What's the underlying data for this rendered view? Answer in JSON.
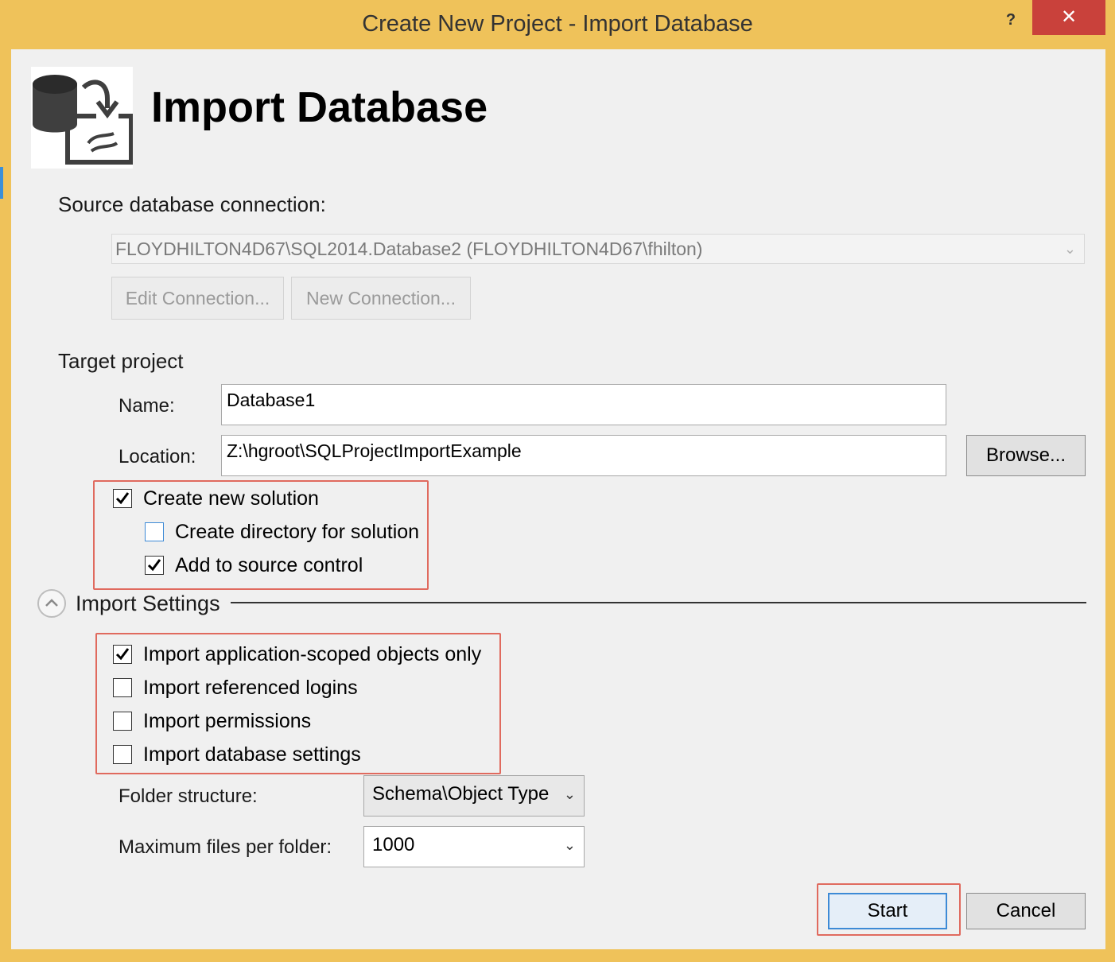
{
  "window": {
    "title": "Create New Project - Import Database",
    "help_label": "?",
    "close_label": "✕"
  },
  "header": {
    "heading": "Import Database",
    "icon": "import-database-icon"
  },
  "source": {
    "label": "Source database connection:",
    "connection_value": "FLOYDHILTON4D67\\SQL2014.Database2 (FLOYDHILTON4D67\\fhilton)",
    "edit_connection_label": "Edit Connection...",
    "new_connection_label": "New Connection..."
  },
  "target": {
    "label": "Target project",
    "name_label": "Name:",
    "name_value": "Database1",
    "location_label": "Location:",
    "location_value": "Z:\\hgroot\\SQLProjectImportExample",
    "browse_label": "Browse..."
  },
  "solution_options": [
    {
      "label": "Create new solution",
      "checked": true
    },
    {
      "label": "Create directory for solution",
      "checked": false
    },
    {
      "label": "Add to source control",
      "checked": true
    }
  ],
  "import_settings": {
    "label": "Import Settings",
    "options": [
      {
        "label": "Import application-scoped objects only",
        "checked": true
      },
      {
        "label": "Import referenced logins",
        "checked": false
      },
      {
        "label": "Import permissions",
        "checked": false
      },
      {
        "label": "Import database settings",
        "checked": false
      }
    ],
    "folder_structure_label": "Folder structure:",
    "folder_structure_value": "Schema\\Object Type",
    "max_files_label": "Maximum files per folder:",
    "max_files_value": "1000"
  },
  "footer": {
    "start_label": "Start",
    "cancel_label": "Cancel"
  },
  "colors": {
    "titlebar": "#efc25a",
    "close_button": "#c9413b",
    "highlight_box": "#e06a5e",
    "default_button_border": "#3d8ad6"
  }
}
